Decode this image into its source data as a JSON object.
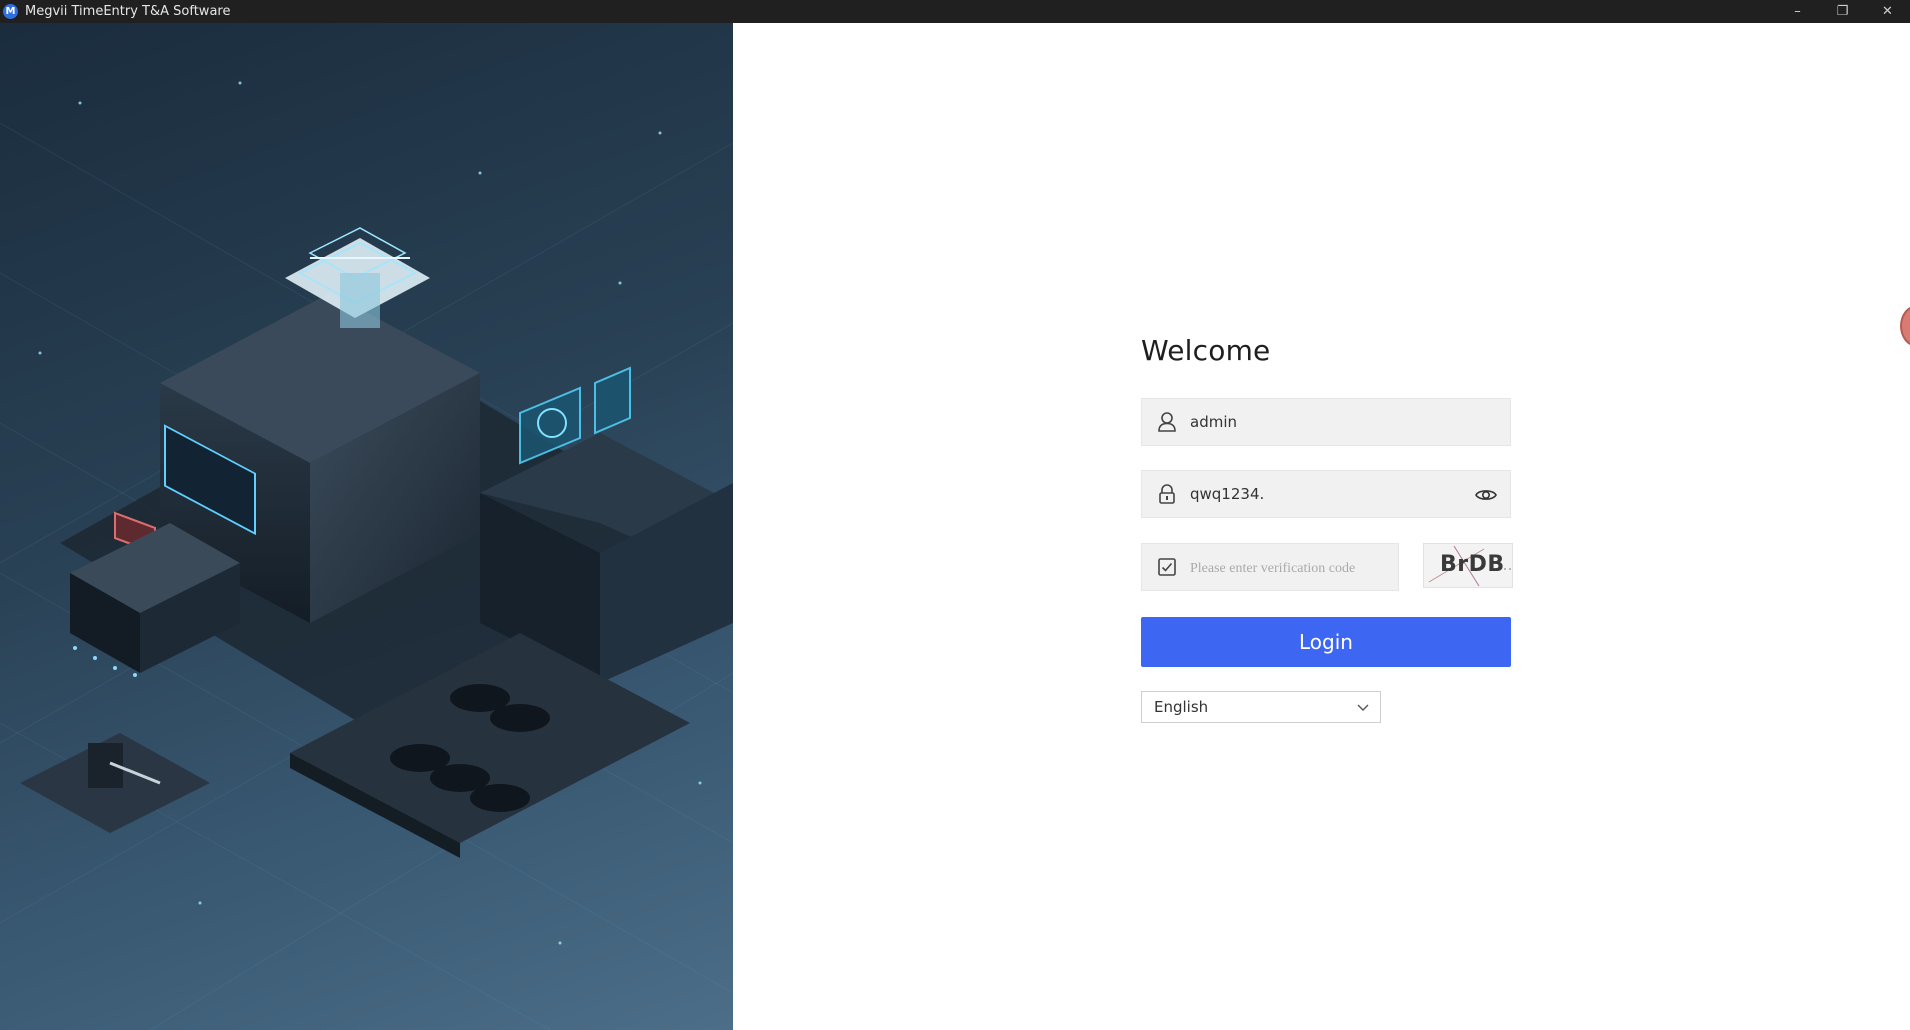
{
  "window": {
    "title": "Megvii TimeEntry T&A Software",
    "app_icon_letter": "M",
    "controls": {
      "minimize": "–",
      "restore": "❐",
      "close": "✕"
    }
  },
  "login": {
    "heading": "Welcome",
    "username_value": "admin",
    "password_value": "qwq1234.",
    "verification_placeholder": "Please enter verification code",
    "captcha_text": "BrDB",
    "submit_label": "Login",
    "language_selected": "English"
  },
  "icons": {
    "username": "user-icon",
    "password": "lock-icon",
    "verification": "checkbox-icon",
    "show_password": "eye-icon",
    "dropdown": "chevron-down-icon"
  },
  "colors": {
    "accent": "#3d67f2",
    "titlebar": "#202020",
    "field_bg": "#f1f1f1"
  }
}
